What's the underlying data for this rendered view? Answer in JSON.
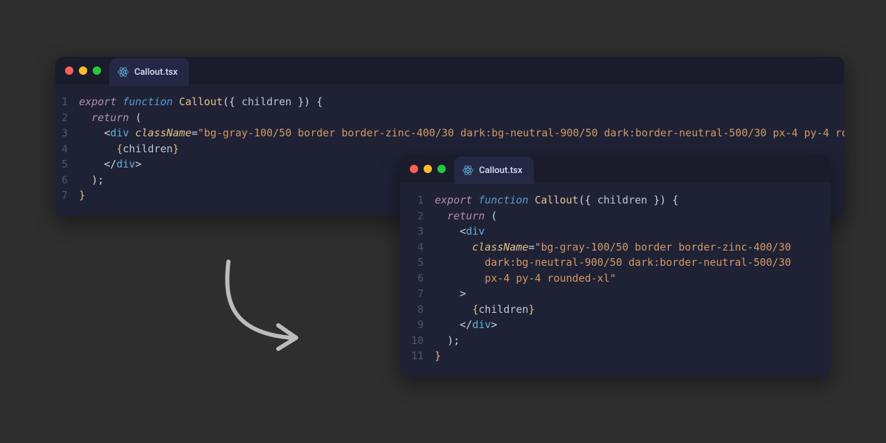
{
  "colors": {
    "page_bg": "#2e2e2e",
    "window_bg": "#1f2235",
    "titlebar_bg": "#1a1c2c",
    "tab_bg": "#252845",
    "gutter": "#4e5472",
    "text": "#d0d3e6",
    "kw": "#b48ead",
    "kw2": "#569cd3",
    "fn": "#e3c28b",
    "tag": "#61b0d6",
    "attr": "#e3c28b",
    "str": "#d19a66",
    "brace": "#e4bf7a",
    "traffic_red": "#ff5f57",
    "traffic_yellow": "#febc2e",
    "traffic_green": "#28c840",
    "react_icon": "#5fb3d4",
    "arrow": "#bcbcbc"
  },
  "back": {
    "tab_label": "Callout.tsx",
    "line_count": 7,
    "lines": {
      "1": {
        "kw_export": "export",
        "kw_function": "function",
        "fn": "Callout",
        "params_open": "({ ",
        "param": "children",
        "params_close": " }) {"
      },
      "2": {
        "indent": "  ",
        "kw_return": "return",
        "paren": " ("
      },
      "3": {
        "indent": "    ",
        "open": "<",
        "tag": "div",
        "sp": " ",
        "attr": "className",
        "eq": "=",
        "q1": "\"",
        "str": "bg-gray-100/50 border border-zinc-400/30 dark:bg-neutral-900/50 dark:border-neutral-500/30 px-4 py-4",
        "tail": " rounded-xl\">"
      },
      "4": {
        "indent": "      ",
        "lb": "{",
        "expr": "children",
        "rb": "}"
      },
      "5": {
        "indent": "    ",
        "open": "</",
        "tag": "div",
        "close": ">"
      },
      "6": {
        "indent": "  ",
        "text": ");"
      },
      "7": {
        "text": "}"
      }
    }
  },
  "front": {
    "tab_label": "Callout.tsx",
    "line_count": 11,
    "lines": {
      "1": {
        "kw_export": "export",
        "kw_function": "function",
        "fn": "Callout",
        "params_open": "({ ",
        "param": "children",
        "params_close": " }) {"
      },
      "2": {
        "indent": "  ",
        "kw_return": "return",
        "paren": " ("
      },
      "3": {
        "indent": "    ",
        "open": "<",
        "tag": "div"
      },
      "4": {
        "indent": "      ",
        "attr": "className",
        "eq": "=",
        "q1": "\"",
        "str": "bg-gray-100/50 border border-zinc-400/30"
      },
      "5": {
        "indent": "        ",
        "str": "dark:bg-neutral-900/50 dark:border-neutral-500/30"
      },
      "6": {
        "indent": "        ",
        "str": "px-4 py-4 rounded-xl",
        "q2": "\""
      },
      "7": {
        "indent": "    ",
        "close": ">"
      },
      "8": {
        "indent": "      ",
        "lb": "{",
        "expr": "children",
        "rb": "}"
      },
      "9": {
        "indent": "    ",
        "open": "</",
        "tag": "div",
        "close": ">"
      },
      "10": {
        "indent": "  ",
        "text": ");"
      },
      "11": {
        "text": "}"
      }
    }
  }
}
